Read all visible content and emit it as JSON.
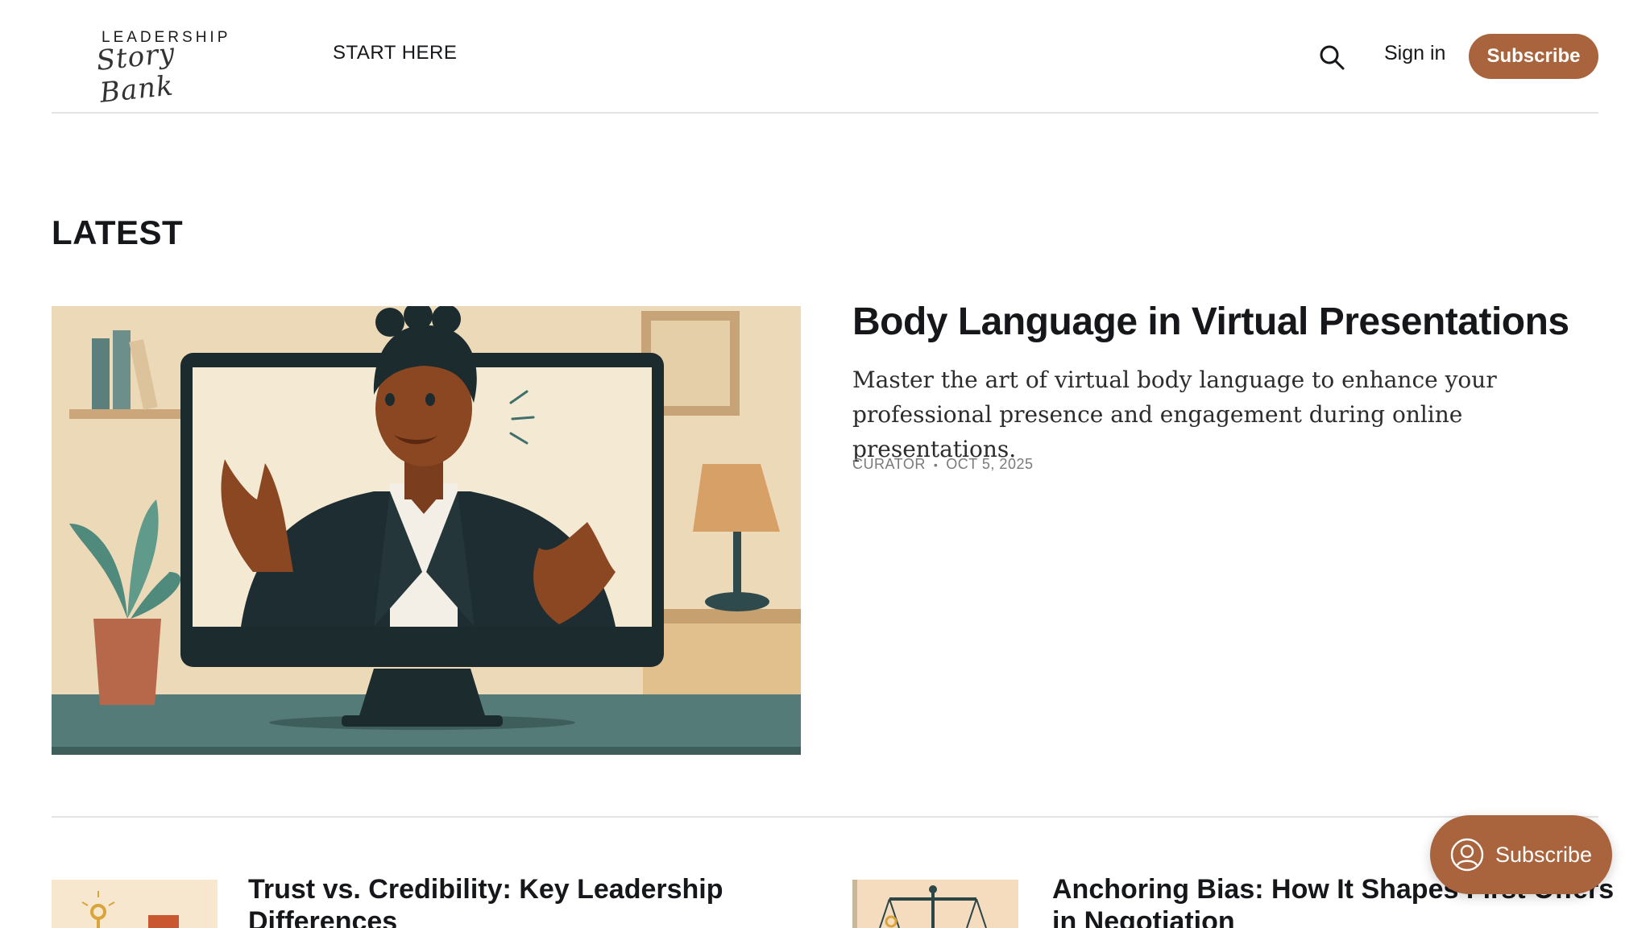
{
  "header": {
    "logo_top": "LEADERSHIP",
    "logo_script": "Story Bank",
    "nav_start": "START HERE",
    "search_icon": "search-icon",
    "signin_label": "Sign in",
    "subscribe_label": "Subscribe"
  },
  "latest": {
    "heading": "LATEST",
    "feature": {
      "title": "Body Language in Virtual Presentations",
      "excerpt": "Master the art of virtual body language to enhance your professional presence and engagement during online presentations.",
      "author": "CURATOR",
      "separator": "•",
      "date": "OCT 5, 2025"
    }
  },
  "cards": [
    {
      "title": "Trust vs. Credibility: Key Leadership Differences"
    },
    {
      "title": "Anchoring Bias: How It Shapes First Offers in Negotiation"
    }
  ],
  "floating": {
    "subscribe_label": "Subscribe",
    "icon": "user-circle-icon"
  },
  "colors": {
    "accent": "#a9643e",
    "text": "#15171a",
    "meta": "#7a7a7a",
    "divider": "#e4e4e4"
  }
}
